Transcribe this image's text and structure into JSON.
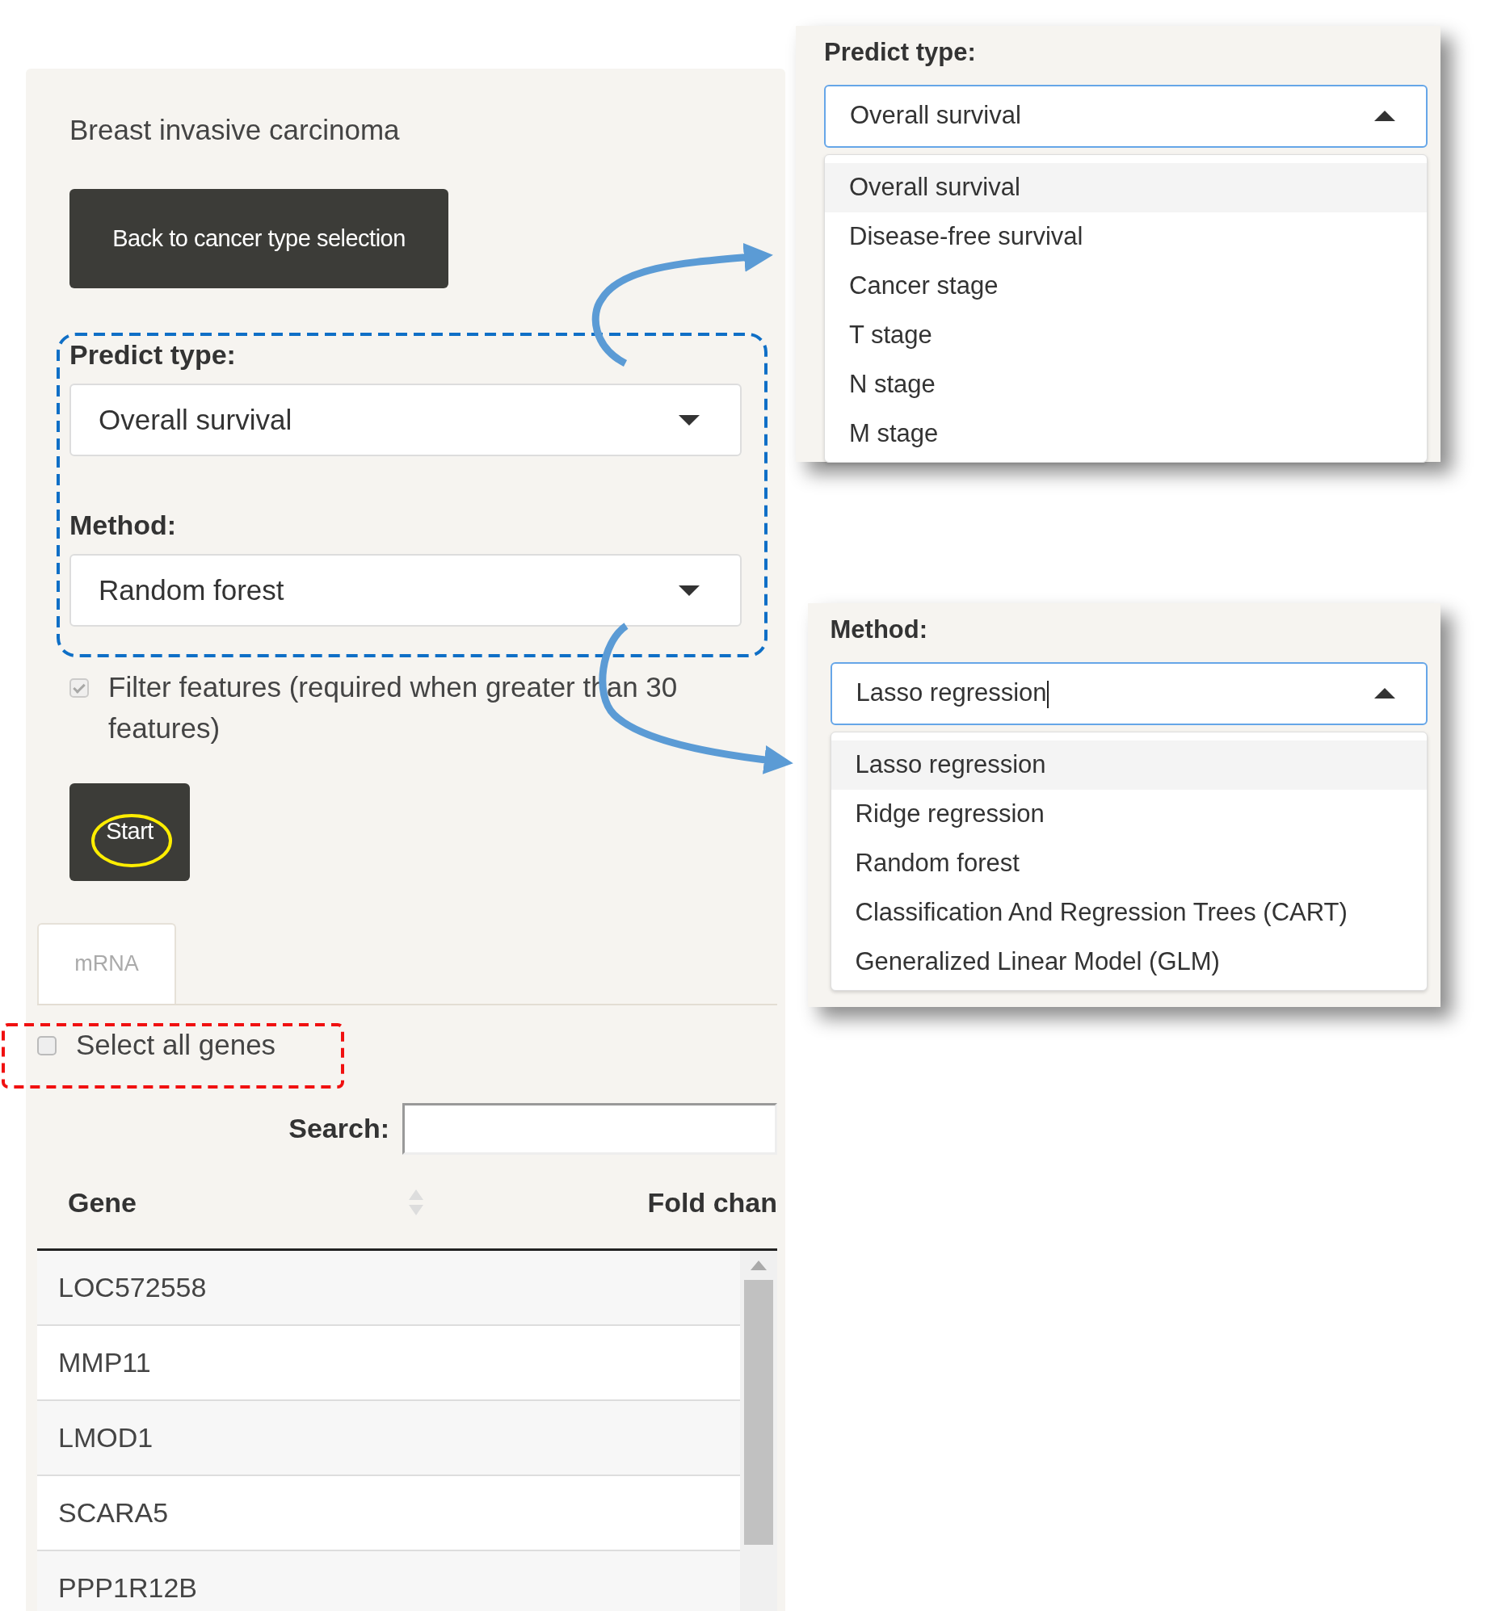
{
  "panel": {
    "title": "Breast invasive carcinoma",
    "back_button": "Back to cancer type selection",
    "predict_type": {
      "label": "Predict type:",
      "value": "Overall survival",
      "expanded": false
    },
    "method": {
      "label": "Method:",
      "value": "Random forest",
      "expanded": false
    },
    "filter": {
      "label": "Filter features (required when greater than 30 features)",
      "checked": true,
      "disabled": true
    },
    "start_button": "Start",
    "tabs": [
      {
        "label": "mRNA",
        "selected": true
      }
    ],
    "select_all": {
      "label": "Select all genes",
      "checked": false
    },
    "search": {
      "label": "Search:"
    },
    "table": {
      "columns": [
        "Gene",
        "Fold chan"
      ],
      "rows": [
        [
          "LOC572558"
        ],
        [
          "MMP11"
        ],
        [
          "LMOD1"
        ],
        [
          "SCARA5"
        ],
        [
          "PPP1R12B"
        ]
      ]
    }
  },
  "predict_dropdown": {
    "label": "Predict type:",
    "value": "Overall survival",
    "expanded": true,
    "options": [
      {
        "label": "Overall survival",
        "selected": true
      },
      {
        "label": "Disease-free survival",
        "selected": false
      },
      {
        "label": "Cancer stage",
        "selected": false
      },
      {
        "label": "T stage",
        "selected": false
      },
      {
        "label": "N stage",
        "selected": false
      },
      {
        "label": "M stage",
        "selected": false
      }
    ]
  },
  "method_dropdown": {
    "label": "Method:",
    "value": "Lasso regression",
    "expanded": true,
    "text_cursor": true,
    "options": [
      {
        "label": "Lasso regression",
        "selected": true
      },
      {
        "label": "Ridge regression",
        "selected": false
      },
      {
        "label": "Random forest",
        "selected": false
      },
      {
        "label": "Classification And Regression Trees (CART)",
        "selected": false
      },
      {
        "label": "Generalized Linear Model (GLM)",
        "selected": false
      }
    ]
  }
}
